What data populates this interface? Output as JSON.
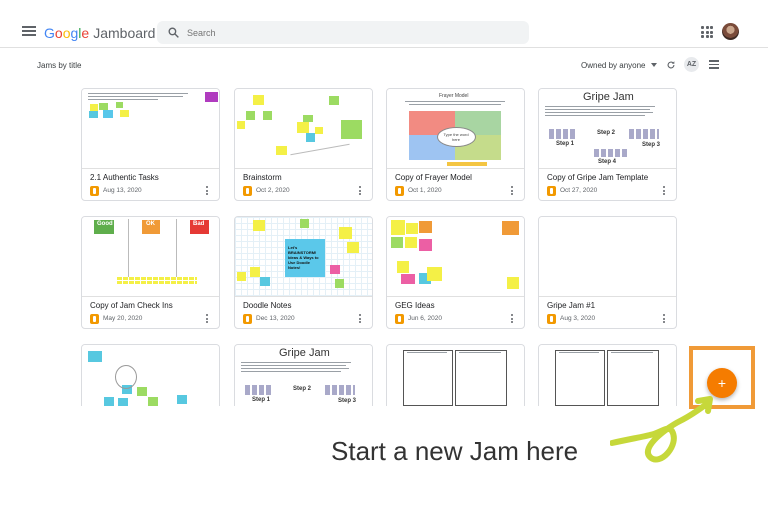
{
  "header": {
    "app_name": "Jamboard",
    "search_placeholder": "Search"
  },
  "toolbar": {
    "section_title": "Jams by title",
    "owner_filter": "Owned by anyone",
    "sort_label": "AZ"
  },
  "cards": [
    {
      "title": "2.1 Authentic Tasks",
      "date": "Aug 13, 2020"
    },
    {
      "title": "Brainstorm",
      "date": "Oct 2, 2020"
    },
    {
      "title": "Copy of Frayer Model",
      "date": "Oct 1, 2020"
    },
    {
      "title": "Copy of Gripe Jam Template",
      "date": "Oct 27, 2020"
    },
    {
      "title": "Copy of Jam Check Ins",
      "date": "May 20, 2020"
    },
    {
      "title": "Doodle Notes",
      "date": "Dec 13, 2020"
    },
    {
      "title": "GEG Ideas",
      "date": "Jun 6, 2020"
    },
    {
      "title": "Gripe Jam #1",
      "date": "Aug 3, 2020"
    }
  ],
  "thumbnails": {
    "frayer_title": "Frayer Model",
    "frayer_center": "Type the word here",
    "gripe_title": "Gripe Jam",
    "step1": "Step 1",
    "step2": "Step 2",
    "step3": "Step 3",
    "step4": "Step 4",
    "good": "Good",
    "ok": "OK",
    "bad": "Bad",
    "doodle_note": "Let's BRAINSTORM! Ideas & Ways to Use Doodle Notes!"
  },
  "fab": {
    "label": "+"
  },
  "caption": "Start a new Jam here",
  "colors": {
    "accent": "#f57c00",
    "highlight_border": "#f09a37",
    "arrow": "#c6d83a"
  }
}
